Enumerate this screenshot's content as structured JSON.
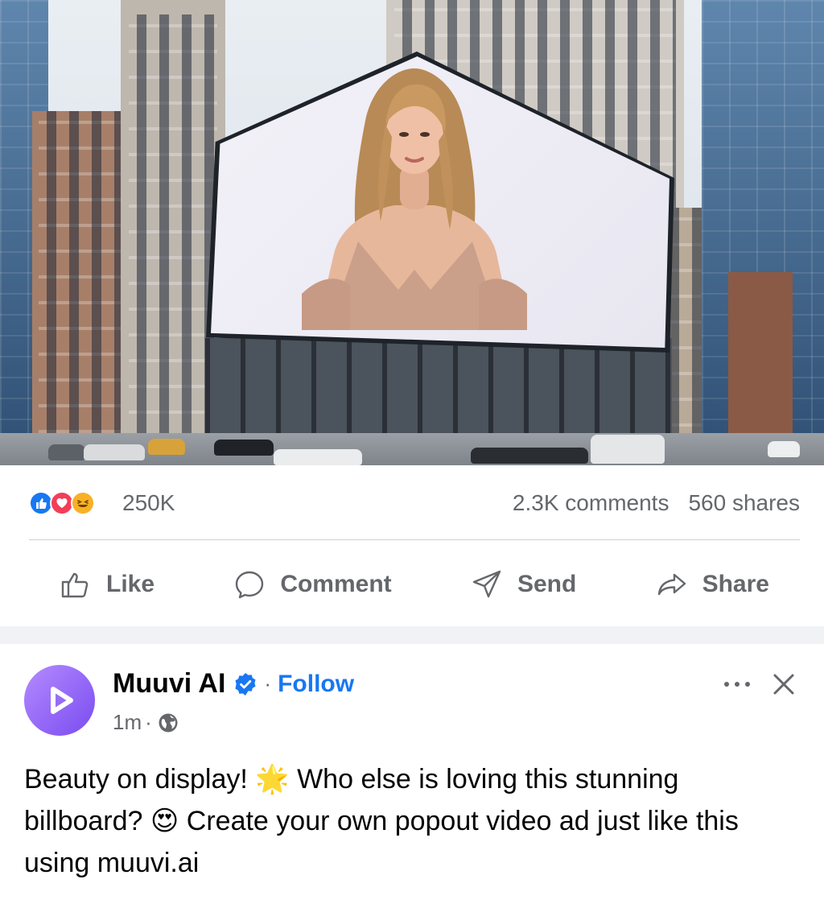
{
  "post": {
    "reactions": {
      "icons": [
        "like-icon",
        "love-icon",
        "haha-icon"
      ],
      "count": "250K"
    },
    "comments": "2.3K comments",
    "shares": "560 shares",
    "actions": {
      "like": "Like",
      "comment": "Comment",
      "send": "Send",
      "share": "Share"
    }
  },
  "next_post": {
    "author": "Muuvi AI",
    "verified": true,
    "separator": "·",
    "follow": "Follow",
    "time": "1m",
    "time_separator": "·",
    "text_parts": {
      "p1": "Beauty on display! ",
      "emoji1": "🌟",
      "p2": " Who else is loving this stunning billboard? ",
      "emoji2": "😍",
      "p3": " Create your own popout video ad just like this using muuvi.ai"
    }
  },
  "colors": {
    "accent": "#1877f2",
    "love": "#f33e58",
    "haha": "#f7b125",
    "muted_text": "#65676b",
    "avatar": "#8a5cf6"
  }
}
